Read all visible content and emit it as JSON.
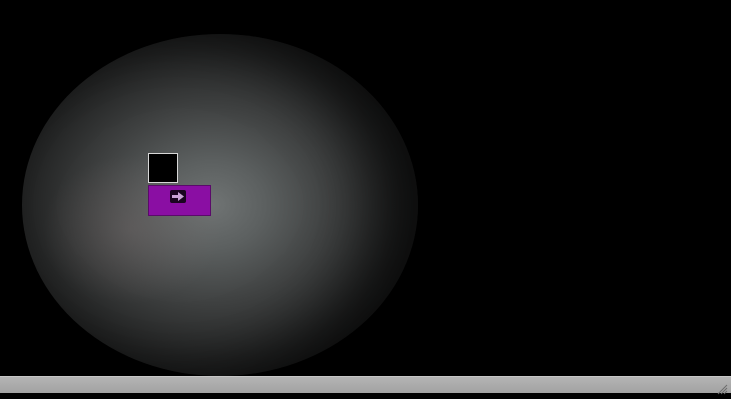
{
  "scene": {
    "background_color": "#000000",
    "spotlight_color": "#707474"
  },
  "tiles": {
    "dark_tile_color": "#000000",
    "tool_tile_color": "#8a0ea3",
    "tool_tile_icon": "arrow-right-icon"
  },
  "status_bar": {
    "color": "#a8a8a8",
    "grip_icon": "resize-grip-icon"
  }
}
